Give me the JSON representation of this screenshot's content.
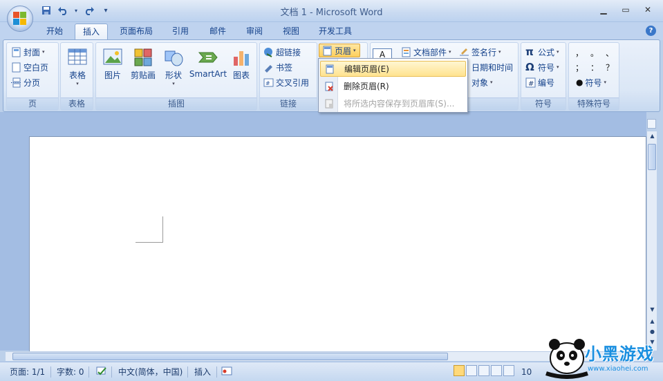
{
  "window": {
    "title": "文档 1 - Microsoft Word",
    "controls": {
      "minimize": "▁",
      "restore": "▭",
      "close": "✕"
    }
  },
  "quick_access": {
    "customize": "▾"
  },
  "tabs": [
    {
      "label": "开始",
      "active": false
    },
    {
      "label": "插入",
      "active": true
    },
    {
      "label": "页面布局",
      "active": false
    },
    {
      "label": "引用",
      "active": false
    },
    {
      "label": "邮件",
      "active": false
    },
    {
      "label": "审阅",
      "active": false
    },
    {
      "label": "视图",
      "active": false
    },
    {
      "label": "开发工具",
      "active": false
    }
  ],
  "help": "?",
  "ribbon": {
    "pages": {
      "label": "页",
      "cover": "封面",
      "blank": "空白页",
      "break": "分页"
    },
    "tables": {
      "label": "表格",
      "table": "表格"
    },
    "illustrations": {
      "label": "插图",
      "picture": "图片",
      "clipart": "剪贴画",
      "shapes": "形状",
      "smartart": "SmartArt",
      "chart": "图表"
    },
    "links": {
      "label": "链接",
      "hyperlink": "超链接",
      "bookmark": "书签",
      "crossref": "交叉引用"
    },
    "header_footer": {
      "header": "页眉"
    },
    "text": {
      "quickparts": "文档部件",
      "signature": "签名行",
      "datetime": "日期和时间",
      "object": "对象"
    },
    "symbols": {
      "label": "符号",
      "equation": "公式",
      "symbol": "符号",
      "number": "编号"
    },
    "special": {
      "label": "特殊符号",
      "symbol": "符号",
      "chars": [
        "，",
        "。",
        "、",
        "；",
        "：",
        "？"
      ]
    }
  },
  "header_menu": [
    {
      "label": "编辑页眉(E)",
      "highlighted": true,
      "disabled": false
    },
    {
      "label": "删除页眉(R)",
      "highlighted": false,
      "disabled": false
    },
    {
      "label": "将所选内容保存到页眉库(S)...",
      "highlighted": false,
      "disabled": true
    }
  ],
  "status": {
    "page": "页面: 1/1",
    "words": "字数: 0",
    "language": "中文(简体，中国)",
    "mode": "插入",
    "zoom": "10"
  },
  "watermark": {
    "text": "小黑游戏",
    "url": "www.xiaohei.com"
  },
  "colors": {
    "accent": "#15428b",
    "ribbon": "#dbe7f6",
    "highlight": "#ffe38f"
  }
}
